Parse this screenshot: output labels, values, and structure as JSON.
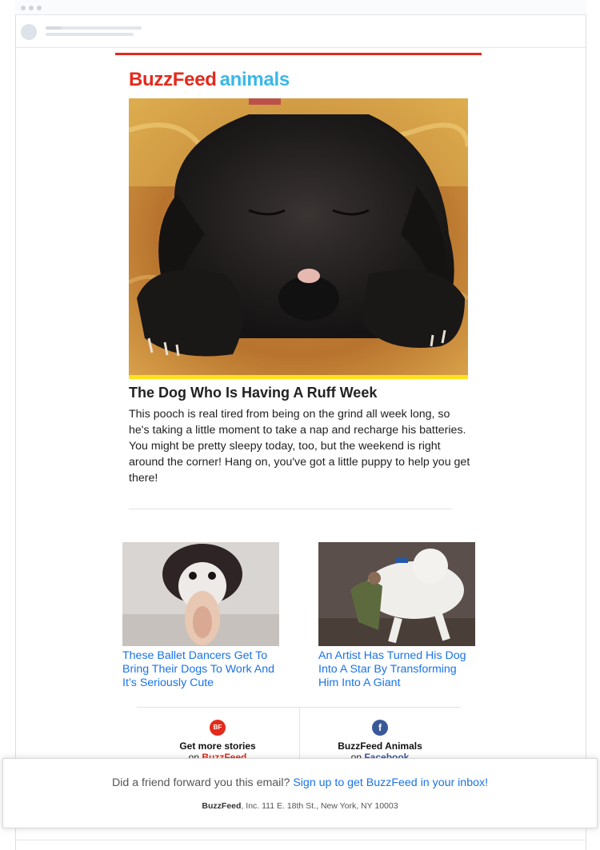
{
  "brand": {
    "name": "BuzzFeed",
    "section": "animals",
    "red": "#e32a1d",
    "blue": "#3ab8e8",
    "link": "#1a73e8"
  },
  "hero": {
    "image_alt": "sleeping black puppy",
    "title": "The Dog Who Is Having A Ruff Week",
    "body": "This pooch is real tired from being on the grind all week long, so he's taking a little moment to take a nap and recharge his batteries. You might be pretty sleepy today, too, but the weekend is right around the corner! Hang on, you've got a little puppy to help you get there!"
  },
  "stories": [
    {
      "image_alt": "shih tzu with ballet slipper",
      "title": "These Ballet Dancers Get To Bring Their Dogs To Work And It’s Seriously Cute"
    },
    {
      "image_alt": "man riding giant white dog",
      "title": "An Artist Has Turned His Dog Into A Star By Transforming Him Into A Giant"
    }
  ],
  "footer": {
    "left": {
      "badge": "BF",
      "line1": "Get more stories",
      "prefix": "on",
      "target": "BuzzFeed"
    },
    "right": {
      "badge": "f",
      "line1": "BuzzFeed Animals",
      "prefix": "on",
      "target": "Facebook"
    }
  },
  "overlay": {
    "question": "Did a friend forward you this email?",
    "signup": "Sign up to get BuzzFeed in your inbox!",
    "company": "BuzzFeed",
    "address": ", Inc. 111 E. 18th St., New York, NY 10003"
  }
}
